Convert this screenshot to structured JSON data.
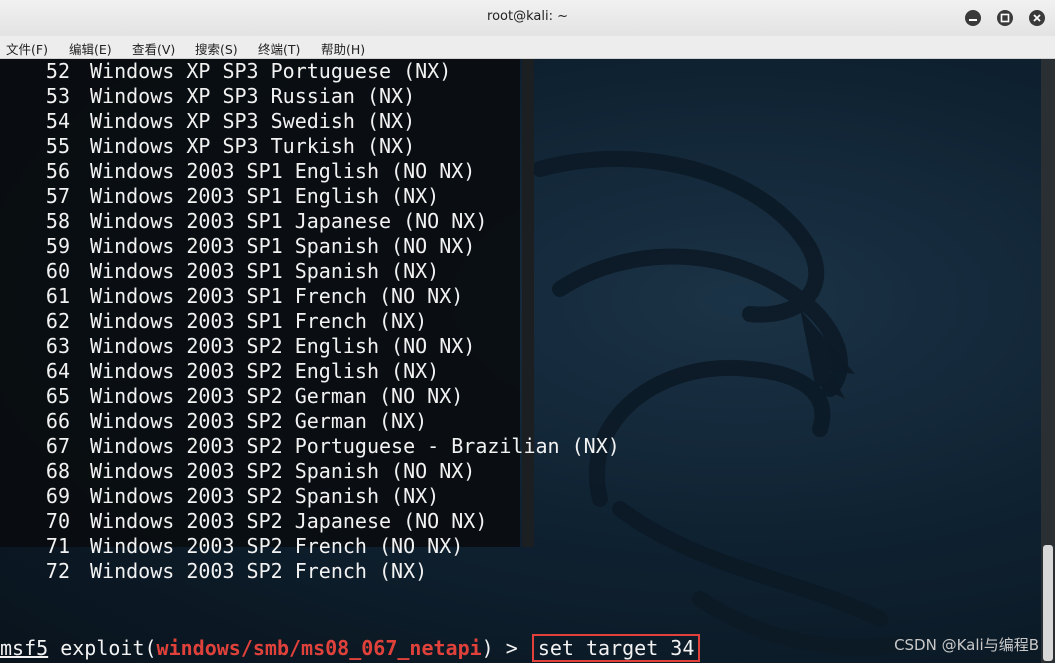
{
  "window": {
    "title": "root@kali: ~"
  },
  "menu": [
    {
      "label": "文件(F)"
    },
    {
      "label": "编辑(E)"
    },
    {
      "label": "查看(V)"
    },
    {
      "label": "搜索(S)"
    },
    {
      "label": "终端(T)"
    },
    {
      "label": "帮助(H)"
    }
  ],
  "targets": [
    {
      "num": "52",
      "name": "Windows XP SP3 Portuguese (NX)"
    },
    {
      "num": "53",
      "name": "Windows XP SP3 Russian (NX)"
    },
    {
      "num": "54",
      "name": "Windows XP SP3 Swedish (NX)"
    },
    {
      "num": "55",
      "name": "Windows XP SP3 Turkish (NX)"
    },
    {
      "num": "56",
      "name": "Windows 2003 SP1 English (NO NX)"
    },
    {
      "num": "57",
      "name": "Windows 2003 SP1 English (NX)"
    },
    {
      "num": "58",
      "name": "Windows 2003 SP1 Japanese (NO NX)"
    },
    {
      "num": "59",
      "name": "Windows 2003 SP1 Spanish (NO NX)"
    },
    {
      "num": "60",
      "name": "Windows 2003 SP1 Spanish (NX)"
    },
    {
      "num": "61",
      "name": "Windows 2003 SP1 French (NO NX)"
    },
    {
      "num": "62",
      "name": "Windows 2003 SP1 French (NX)"
    },
    {
      "num": "63",
      "name": "Windows 2003 SP2 English (NO NX)"
    },
    {
      "num": "64",
      "name": "Windows 2003 SP2 English (NX)"
    },
    {
      "num": "65",
      "name": "Windows 2003 SP2 German (NO NX)"
    },
    {
      "num": "66",
      "name": "Windows 2003 SP2 German (NX)"
    },
    {
      "num": "67",
      "name": "Windows 2003 SP2 Portuguese - Brazilian (NX)"
    },
    {
      "num": "68",
      "name": "Windows 2003 SP2 Spanish (NO NX)"
    },
    {
      "num": "69",
      "name": "Windows 2003 SP2 Spanish (NX)"
    },
    {
      "num": "70",
      "name": "Windows 2003 SP2 Japanese (NO NX)"
    },
    {
      "num": "71",
      "name": "Windows 2003 SP2 French (NO NX)"
    },
    {
      "num": "72",
      "name": "Windows 2003 SP2 French (NX)"
    }
  ],
  "prompt": {
    "prefix": "msf5",
    "exploit_open": " exploit(",
    "module": "windows/smb/ms08_067_netapi",
    "exploit_close": ") > ",
    "command": "set target 34"
  },
  "watermark": "CSDN @Kali与编程B",
  "colors": {
    "accent_red": "#e0413a",
    "terminal_text": "#f2f2f2",
    "background": "#0f2232"
  },
  "icons": [
    "minimize-icon",
    "maximize-icon",
    "close-icon",
    "kali-dragon-icon"
  ]
}
